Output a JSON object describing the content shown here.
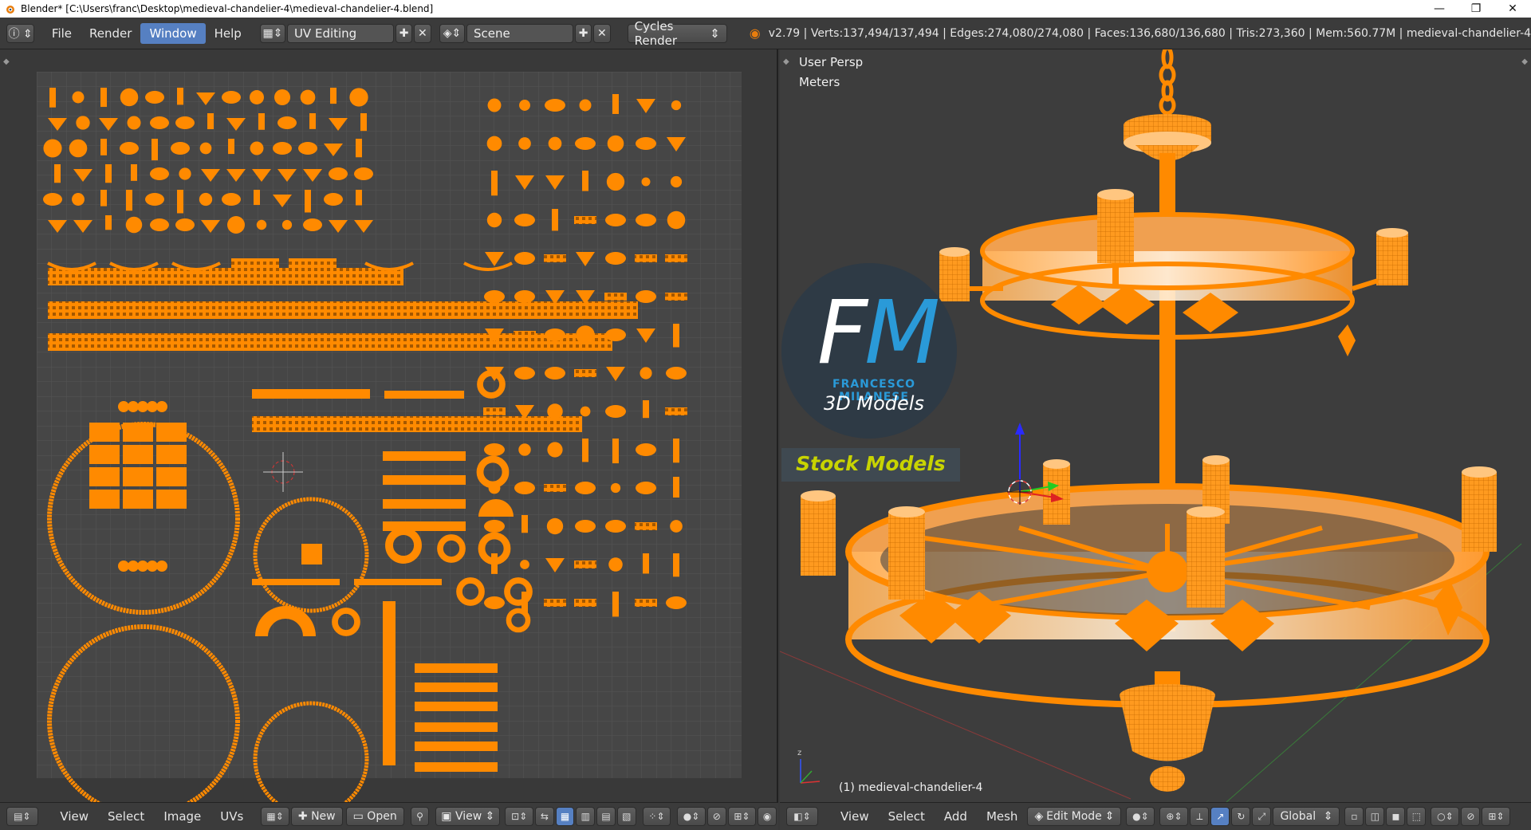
{
  "window": {
    "title": "Blender* [C:\\Users\\franc\\Desktop\\medieval-chandelier-4\\medieval-chandelier-4.blend]",
    "minimize": "—",
    "maximize": "❐",
    "close": "✕"
  },
  "info_header": {
    "menus": [
      "File",
      "Render",
      "Window",
      "Help"
    ],
    "active_menu": "Window",
    "screen_layout": "UV Editing",
    "scene": "Scene",
    "render_engine": "Cycles Render",
    "stats": "v2.79 | Verts:137,494/137,494 | Edges:274,080/274,080 | Faces:136,680/136,680 | Tris:273,360 | Mem:560.77M | medieval-chandelier-4"
  },
  "uv_editor": {
    "footer": {
      "menus": [
        "View",
        "Select",
        "Image",
        "UVs"
      ],
      "new_label": "New",
      "open_label": "Open",
      "view_label": "View"
    }
  },
  "viewport": {
    "view_name": "User Persp",
    "units": "Meters",
    "object_label": "(1) medieval-chandelier-4",
    "watermark": {
      "brand_initials": "FM",
      "brand_name": "FRANCESCO MILANESE",
      "brand_sub": "3D Models",
      "tag": "Stock Models"
    },
    "footer": {
      "menus": [
        "View",
        "Select",
        "Add",
        "Mesh"
      ],
      "mode": "Edit Mode",
      "orientation": "Global"
    }
  },
  "colors": {
    "accent": "#5680c2",
    "mesh_orange": "#ff8a00",
    "background": "#393939"
  }
}
